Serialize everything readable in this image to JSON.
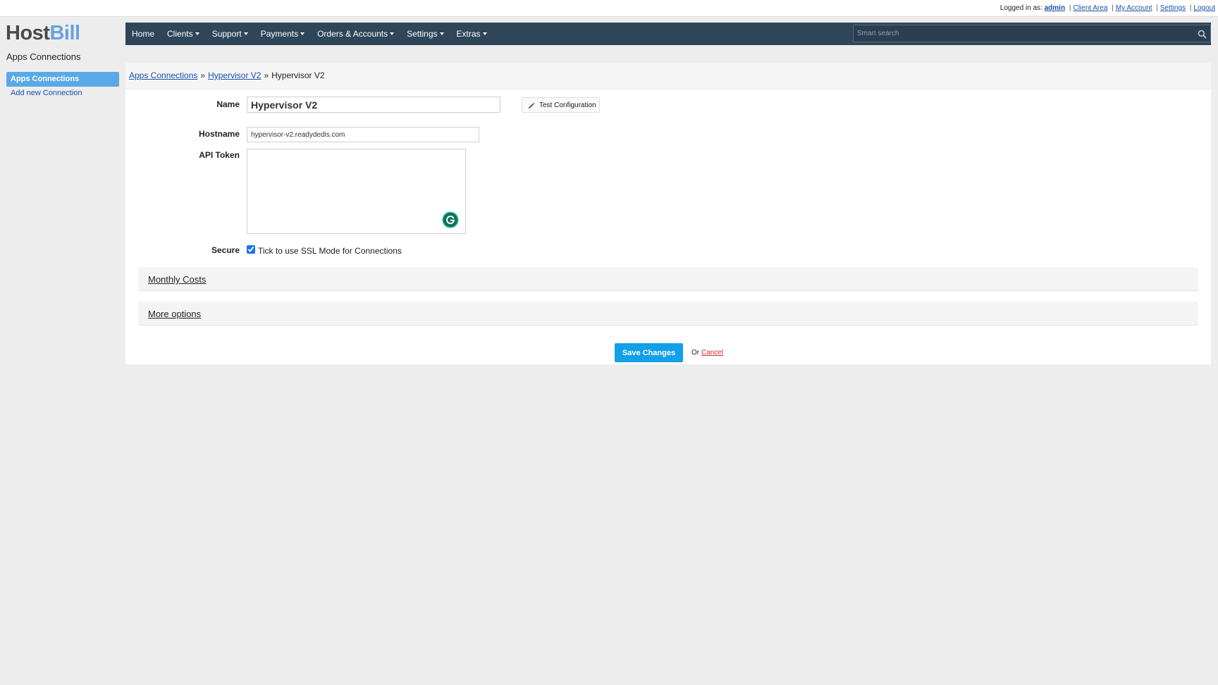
{
  "header": {
    "logged_in_label": "Logged in as:",
    "username": "admin",
    "links": [
      "Client Area",
      "My Account",
      "Settings",
      "Logout"
    ],
    "separator": "|"
  },
  "logo": {
    "part1": "Host",
    "part2": "Bill"
  },
  "section_title": "Apps Connections",
  "sidebar": {
    "items": [
      {
        "label": "Apps Connections",
        "active": true
      },
      {
        "label": "Add new Connection",
        "active": false
      }
    ]
  },
  "nav": {
    "items": [
      {
        "label": "Home",
        "dropdown": false
      },
      {
        "label": "Clients",
        "dropdown": true
      },
      {
        "label": "Support",
        "dropdown": true
      },
      {
        "label": "Payments",
        "dropdown": true
      },
      {
        "label": "Orders & Accounts",
        "dropdown": true
      },
      {
        "label": "Settings",
        "dropdown": true
      },
      {
        "label": "Extras",
        "dropdown": true
      }
    ],
    "search_placeholder": "Smart search",
    "search_icon": "magnifier-icon"
  },
  "breadcrumb": {
    "items": [
      "Apps Connections",
      "Hypervisor V2"
    ],
    "current": "Hypervisor V2",
    "separator": "»"
  },
  "form": {
    "name_label": "Name",
    "name_value": "Hypervisor V2",
    "test_button": "Test Configuration",
    "hostname_label": "Hostname",
    "hostname_value": "hypervisor-v2.readydedis.com",
    "api_token_label": "API Token",
    "api_token_value": "",
    "secure_label": "Secure",
    "secure_checked": true,
    "secure_text": "Tick to use SSL Mode for Connections"
  },
  "sections": [
    "Monthly Costs",
    "More options"
  ],
  "actions": {
    "save": "Save Changes",
    "or_text": "Or",
    "cancel": "Cancel"
  },
  "colors": {
    "nav_bg": "#2f4559",
    "sidebar_active": "#5aa9e6",
    "save_button": "#12a0e8",
    "cancel_link": "#d9262a",
    "logo_accent": "#6aa0e0"
  }
}
